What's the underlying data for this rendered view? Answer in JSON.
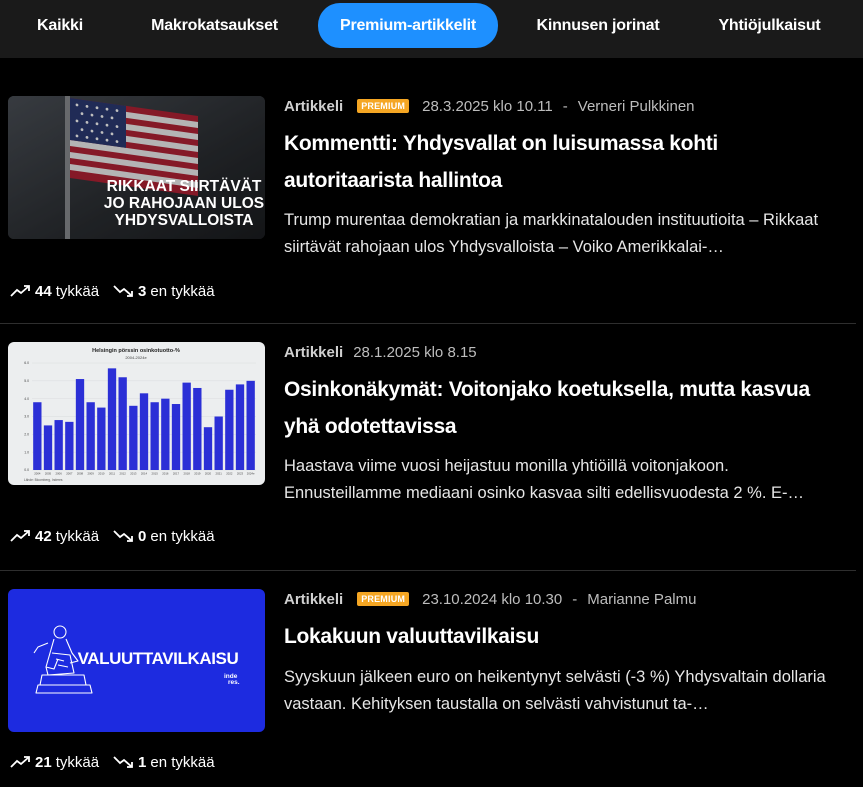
{
  "tabs": [
    {
      "label": "Kaikki",
      "active": false
    },
    {
      "label": "Makrokatsaukset",
      "active": false
    },
    {
      "label": "Premium-artikkelit",
      "active": true
    },
    {
      "label": "Kinnusen jorinat",
      "active": false
    },
    {
      "label": "Yhtiöjulkaisut",
      "active": false
    }
  ],
  "colors": {
    "accent": "#1e90ff",
    "premium_badge": "#f5a623",
    "background": "#000000"
  },
  "articles": [
    {
      "type": "Artikkeli",
      "premium_label": "PREMIUM",
      "date": "28.3.2025 klo 10.11",
      "separator": "-",
      "author": "Verneri Pulkkinen",
      "title": "Kommentti: Yhdysvallat on luisumassa kohti autoritaarista hallintoa",
      "summary": "Trump murentaa demokratian ja markkinatalouden instituutioita – Rikkaat siirtävät rahojaan ulos Yhdysvalloista – Voiko Amerikkalai-…",
      "thumbnail_icon": "us-flag-image",
      "thumbnail_text": [
        "RIKKAAT SIIRTÄVÄT",
        "JO RAHOJAAN ULOS",
        "YHDYSVALLOISTA"
      ],
      "likes": "44",
      "likes_label": "tykkää",
      "dislikes": "3",
      "dislikes_label": "en tykkää"
    },
    {
      "type": "Artikkeli",
      "date": "28.1.2025 klo 8.15",
      "title": "Osinkonäkymät: Voitonjako koetuksella, mutta kasvua yhä odotettavissa",
      "summary": "Haastava viime vuosi heijastuu monilla yhtiöillä voitonjakoon. Ennusteillamme mediaani osinko kasvaa silti edellisvuodesta 2 %. E-…",
      "thumbnail_icon": "bar-chart-image",
      "thumbnail_chart_title": "Helsingin pörssin osinkotuotto-%",
      "thumbnail_chart_subtitle": "2004-2024e",
      "thumbnail_chart_values": [
        3.8,
        2.5,
        2.8,
        2.7,
        5.1,
        3.8,
        3.5,
        5.7,
        5.2,
        3.6,
        4.3,
        3.8,
        4.0,
        3.7,
        4.9,
        4.6,
        2.4,
        3.0,
        4.5,
        4.8,
        5.0
      ],
      "thumbnail_chart_years": [
        "2004",
        "2005",
        "2006",
        "2007",
        "2008",
        "2009",
        "2010",
        "2011",
        "2012",
        "2013",
        "2014",
        "2015",
        "2016",
        "2017",
        "2018",
        "2019",
        "2020",
        "2021",
        "2022",
        "2023",
        "2024e"
      ],
      "thumbnail_chart_ticks": [
        "6.0",
        "5.0",
        "4.0",
        "3.0",
        "2.0",
        "1.0",
        "0.0"
      ],
      "thumbnail_chart_source": "Lähde: Bloomberg, Inderes",
      "likes": "42",
      "likes_label": "tykkää",
      "dislikes": "0",
      "dislikes_label": "en tykkää"
    },
    {
      "type": "Artikkeli",
      "premium_label": "PREMIUM",
      "date": "23.10.2024 klo 10.30",
      "separator": "-",
      "author": "Marianne Palmu",
      "title": "Lokakuun valuuttavilkaisu",
      "summary": "Syyskuun jälkeen euro on heikentynyt selvästi (-3 %) Yhdysvaltain dollaria vastaan. Kehityksen taustalla on selvästi vahvistunut ta-…",
      "thumbnail_icon": "statue-image",
      "thumbnail_text": "VALUUTTAVILKAISU",
      "thumbnail_logo": "inde\nres.",
      "likes": "21",
      "likes_label": "tykkää",
      "dislikes": "1",
      "dislikes_label": "en tykkää"
    }
  ]
}
